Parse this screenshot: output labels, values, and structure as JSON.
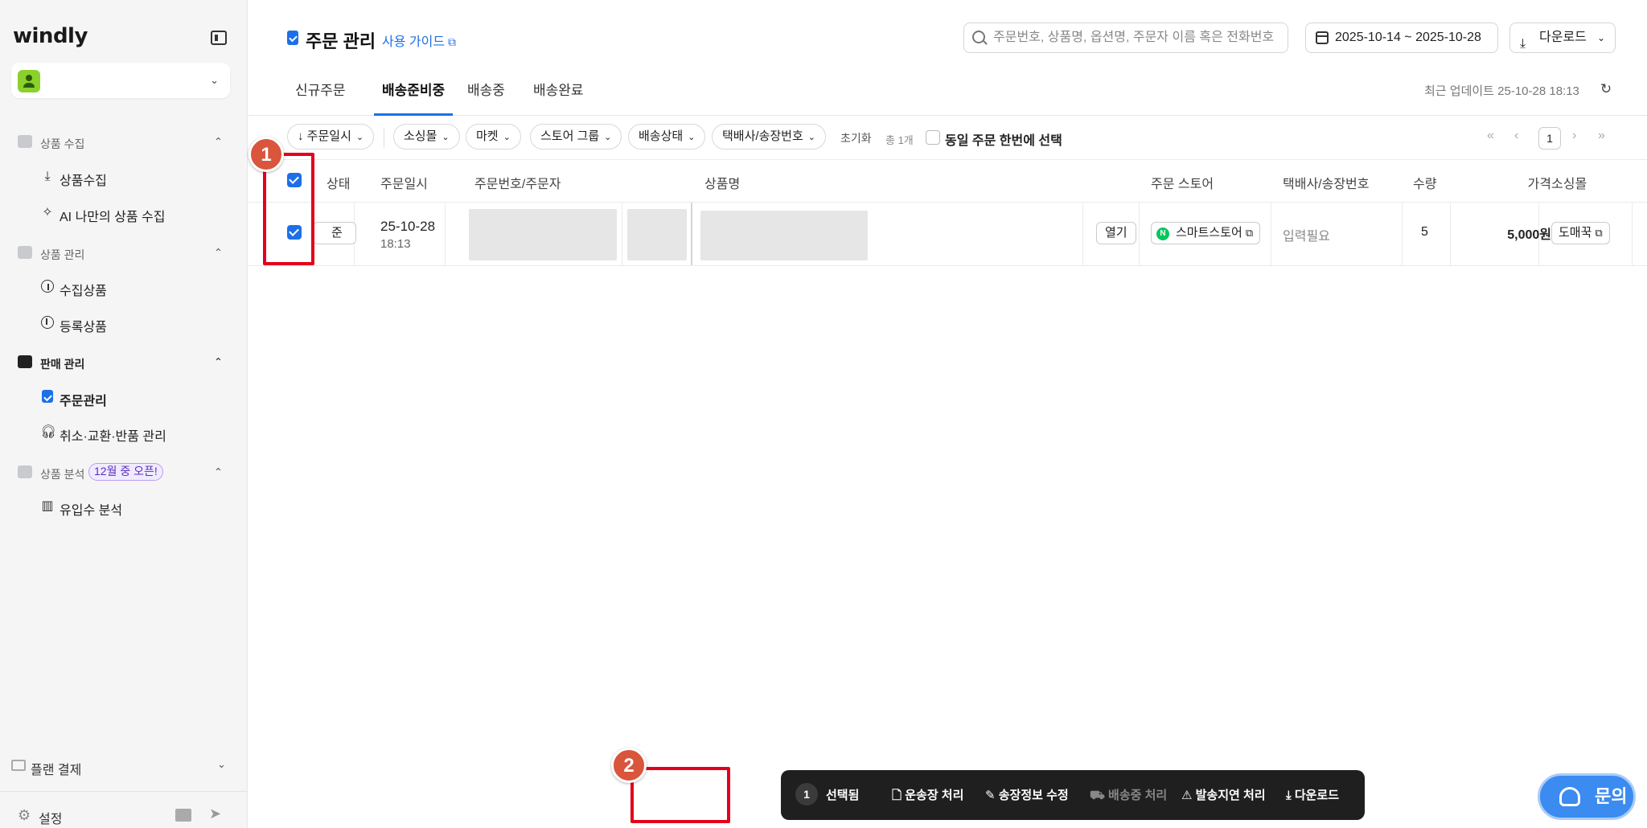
{
  "sidebar": {
    "logo": "windly",
    "sections": [
      {
        "label": "상품 수집",
        "items": [
          "상품수집",
          "AI 나만의 상품 수집"
        ]
      },
      {
        "label": "상품 관리",
        "items": [
          "수집상품",
          "등록상품"
        ]
      },
      {
        "label": "판매 관리",
        "items": [
          "주문관리",
          "취소·교환·반품 관리"
        ]
      },
      {
        "label": "상품 분석",
        "badge": "12월 중 오픈!",
        "items": [
          "유입수 분석"
        ]
      }
    ],
    "plan": "플랜 결제",
    "settings": "설정"
  },
  "header": {
    "title": "주문 관리",
    "guide": "사용 가이드",
    "search_placeholder": "주문번호, 상품명, 옵션명, 주문자 이름 혹은 전화번호",
    "date_range": "2025-10-14 ~ 2025-10-28",
    "download": "다운로드"
  },
  "tabs": [
    "신규주문",
    "배송준비중",
    "배송중",
    "배송완료"
  ],
  "active_tab": 1,
  "updated": "최근 업데이트 25-10-28 18:13",
  "filters": {
    "sort": "주문일시",
    "chips": [
      "소싱몰",
      "마켓",
      "스토어 그룹",
      "배송상태",
      "택배사/송장번호"
    ],
    "reset": "초기화",
    "total": "총 1개",
    "same_order": "동일 주문 한번에 선택",
    "page": "1"
  },
  "table": {
    "headers": [
      "상태",
      "주문일시",
      "주문번호/주문자",
      "상품명",
      "주문 스토어",
      "택배사/송장번호",
      "수량",
      "가격",
      "소싱몰"
    ],
    "row": {
      "status": "준비",
      "date": "25-10-28",
      "time": "18:13",
      "open": "열기",
      "store": "스마트스토어",
      "tracking": "입력필요",
      "qty": "5",
      "price": "5,000원",
      "mall": "도매꾹"
    }
  },
  "action_bar": {
    "count": "1",
    "selected": "선택됨",
    "waybill": "운송장 처리",
    "edit": "송장정보 수정",
    "shipping": "배송중 처리",
    "delay": "발송지연 처리",
    "download": "다운로드"
  },
  "steps": [
    "1",
    "2"
  ],
  "inquiry": "문의",
  "colors": {
    "accent": "#1d6fe8",
    "highlight": "#e4001b",
    "step": "#d9553c"
  }
}
